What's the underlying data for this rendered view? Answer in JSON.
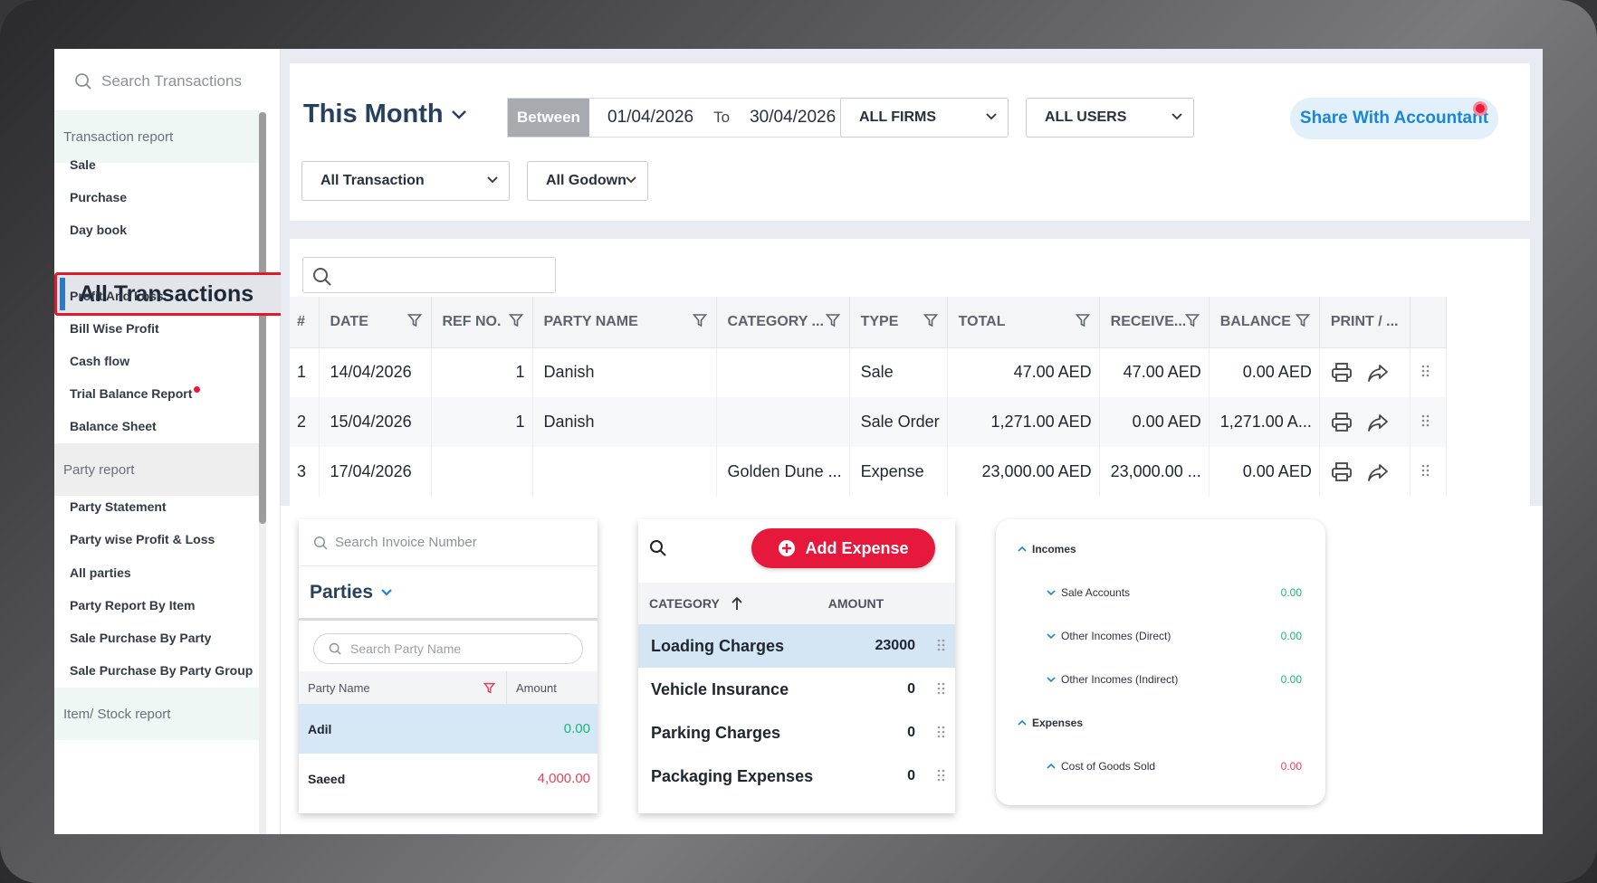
{
  "sidebar": {
    "search_placeholder": "Search Transactions",
    "sections": [
      {
        "title": "Transaction report"
      },
      {
        "title": "Party report"
      },
      {
        "title": "Item/ Stock report"
      }
    ],
    "transaction_items": [
      "Sale",
      "Purchase",
      "Day book",
      "All Transactions",
      "Profit And Loss",
      "Bill Wise Profit",
      "Cash flow",
      "Trial Balance Report",
      "Balance Sheet"
    ],
    "party_items": [
      "Party Statement",
      "Party wise Profit & Loss",
      "All parties",
      "Party Report By Item",
      "Sale Purchase By Party",
      "Sale Purchase By Party Group"
    ],
    "active_item": "All Transactions"
  },
  "filters": {
    "period": "This Month",
    "between_label": "Between",
    "from_date": "01/04/2026",
    "to_label": "To",
    "to_date": "30/04/2026",
    "firms": "ALL FIRMS",
    "users": "ALL USERS",
    "share_label": "Share With Accountant",
    "transaction_type": "All Transaction",
    "godown": "All Godown"
  },
  "table": {
    "columns": [
      "#",
      "DATE",
      "REF NO.",
      "PARTY NAME",
      "CATEGORY ...",
      "TYPE",
      "TOTAL",
      "RECEIVE...",
      "BALANCE",
      "PRINT / ..."
    ],
    "rows": [
      {
        "n": "1",
        "date": "14/04/2026",
        "ref": "1",
        "party": "Danish",
        "category": "",
        "type": "Sale",
        "total": "47.00 AED",
        "received": "47.00 AED",
        "balance": "0.00 AED"
      },
      {
        "n": "2",
        "date": "15/04/2026",
        "ref": "1",
        "party": "Danish",
        "category": "",
        "type": "Sale Order",
        "total": "1,271.00 AED",
        "received": "0.00 AED",
        "balance": "1,271.00 A..."
      },
      {
        "n": "3",
        "date": "17/04/2026",
        "ref": "",
        "party": "",
        "category": "Golden Dune ...",
        "type": "Expense",
        "total": "23,000.00 AED",
        "received": "23,000.00 ...",
        "balance": "0.00 AED"
      }
    ]
  },
  "parties_panel": {
    "invoice_search_placeholder": "Search Invoice Number",
    "title": "Parties",
    "party_search_placeholder": "Search Party Name",
    "col_party": "Party Name",
    "col_amount": "Amount",
    "rows": [
      {
        "name": "Adil",
        "amount": "0.00"
      },
      {
        "name": "Saeed",
        "amount": "4,000.00"
      }
    ]
  },
  "expense_panel": {
    "add_label": "Add Expense",
    "col_category": "CATEGORY",
    "col_amount": "AMOUNT",
    "rows": [
      {
        "name": "Loading Charges",
        "amount": "23000"
      },
      {
        "name": "Vehicle Insurance",
        "amount": "0"
      },
      {
        "name": "Parking Charges",
        "amount": "0"
      },
      {
        "name": "Packaging Expenses",
        "amount": "0"
      }
    ]
  },
  "ledger_panel": {
    "incomes": "Incomes",
    "sale_accounts": "Sale Accounts",
    "sale_accounts_val": "0.00",
    "other_direct": "Other Incomes (Direct)",
    "other_direct_val": "0.00",
    "other_indirect": "Other Incomes (Indirect)",
    "other_indirect_val": "0.00",
    "expenses": "Expenses",
    "cogs": "Cost of Goods Sold",
    "cogs_val": "0.00"
  },
  "colors": {
    "accent_blue": "#26405e",
    "danger_red": "#e6183c",
    "link_blue": "#1b86d6",
    "positive_green": "#1ab37a"
  }
}
